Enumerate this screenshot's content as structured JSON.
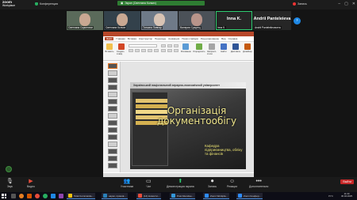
{
  "app": {
    "brand": "zoom",
    "product": "Workplace",
    "meeting_label": "Конференция"
  },
  "sharing_banner": "Экран (Светлана Колких)",
  "recording_label": "Запись",
  "participants": [
    {
      "name": "Светлана Скрипниче",
      "kind": "video"
    },
    {
      "name": "Светлана Колких",
      "kind": "video"
    },
    {
      "name": "Татьяна Пивнар",
      "kind": "video"
    },
    {
      "name": "Валерия Сущинц",
      "kind": "video"
    },
    {
      "name": "Inna K.",
      "sub": "Inna K.",
      "kind": "name",
      "active": true
    },
    {
      "name": "Andrii Panteleieva",
      "sub": "Andrii Panteleiievavera",
      "kind": "name"
    }
  ],
  "ppt": {
    "tabs": [
      "Файл",
      "Главная",
      "Вставка",
      "Конструктор",
      "Переходы",
      "Анимация",
      "Показ слайдов",
      "Рецензирование",
      "Вид",
      "Справка"
    ],
    "ribbon": [
      {
        "label": "Вставить",
        "color": "#f2c14e"
      },
      {
        "label": "Создать слайд",
        "color": "#d24726"
      },
      {
        "label": "Рисование",
        "color": "#5b9bd5"
      },
      {
        "label": "Упорядочить",
        "color": "#70ad47"
      },
      {
        "label": "Экспресс-стили",
        "color": "#a5a5a5"
      },
      {
        "label": "Найти",
        "color": "#4472c4"
      },
      {
        "label": "Диктовать",
        "color": "#2f5597"
      },
      {
        "label": "Дизайнер",
        "color": "#c55a11"
      }
    ],
    "slide_header": "Харківський національний аграрно-економічний університет",
    "slide_title": "Організація документообігу",
    "slide_subtitle": "Кафедра підприємництва, обліку та фінансів"
  },
  "toolbar": {
    "buttons": [
      {
        "label": "Звук",
        "icon": "mic-icon",
        "glyph": "🎤",
        "color": ""
      },
      {
        "label": "Видео",
        "icon": "video-icon",
        "glyph": "📹",
        "color": "red"
      },
      {
        "label": "Участники",
        "icon": "participants-icon",
        "glyph": "👥",
        "color": ""
      },
      {
        "label": "Чат",
        "icon": "chat-icon",
        "glyph": "💬",
        "color": ""
      },
      {
        "label": "Демонстрация экрана",
        "icon": "share-screen-icon",
        "glyph": "⬆",
        "color": "green"
      },
      {
        "label": "Запись",
        "icon": "record-icon",
        "glyph": "⏺",
        "color": ""
      },
      {
        "label": "Реакции",
        "icon": "reactions-icon",
        "glyph": "☺",
        "color": ""
      },
      {
        "label": "Дополнительно",
        "icon": "more-icon",
        "glyph": "•••",
        "color": ""
      }
    ],
    "leave_label": "Выйти"
  },
  "taskbar": {
    "apps": [
      {
        "label": "Total Commande...",
        "color": "#f1c40f"
      },
      {
        "label": "науки, приняв...",
        "color": "#2980b9"
      },
      {
        "label": "(14) Новости...",
        "color": "#e74c3c"
      },
      {
        "label": "Post Attendee...",
        "color": "#3498db"
      },
      {
        "label": "Zoom Workpla...",
        "color": "#2d8cff"
      },
      {
        "label": "Zoom Конфер...",
        "color": "#2d8cff"
      }
    ],
    "lang": "РУС",
    "time": "11:30",
    "date": "30.04.2025"
  }
}
